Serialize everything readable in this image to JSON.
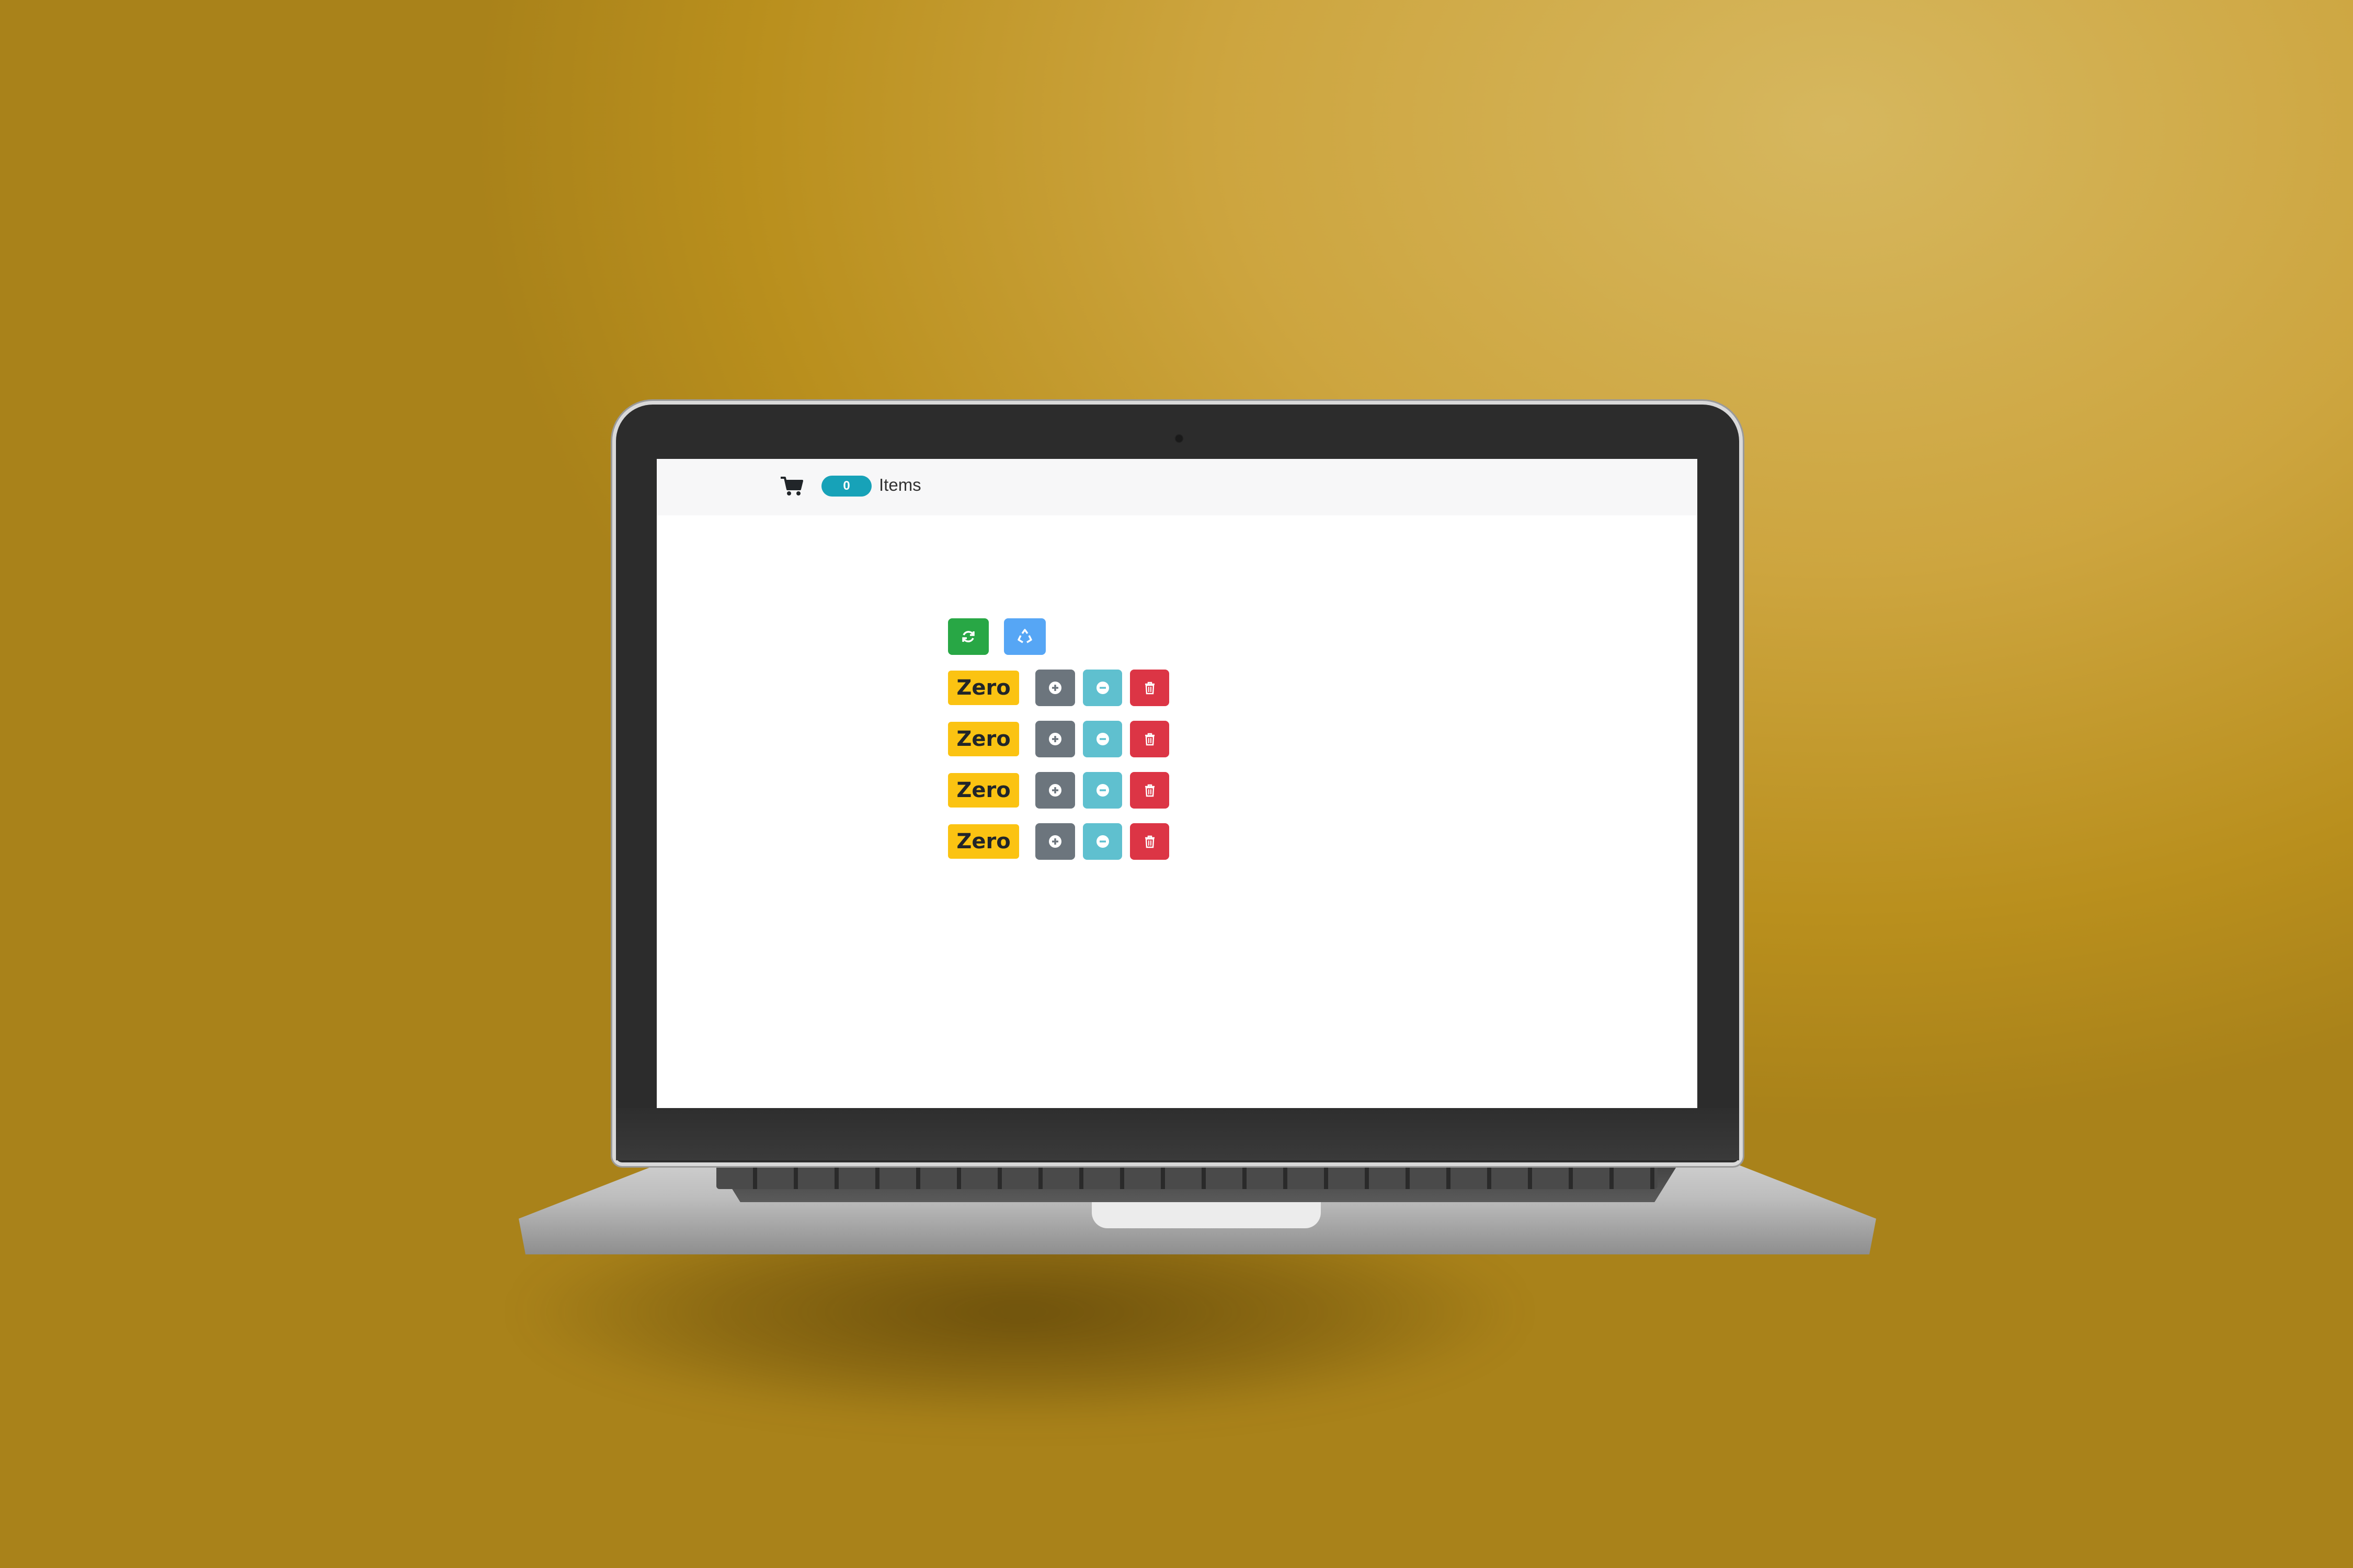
{
  "navbar": {
    "cart_icon": "cart-icon",
    "cart_count": "0",
    "items_label": "Items",
    "badge_color": "#17a2b8"
  },
  "toolbar": {
    "refresh_icon": "refresh-icon",
    "recycle_icon": "recycle-icon"
  },
  "counters": [
    {
      "label": "Zero",
      "increment_icon": "plus-circle-icon",
      "decrement_icon": "minus-circle-icon",
      "delete_icon": "trash-icon"
    },
    {
      "label": "Zero",
      "increment_icon": "plus-circle-icon",
      "decrement_icon": "minus-circle-icon",
      "delete_icon": "trash-icon"
    },
    {
      "label": "Zero",
      "increment_icon": "plus-circle-icon",
      "decrement_icon": "minus-circle-icon",
      "delete_icon": "trash-icon"
    },
    {
      "label": "Zero",
      "increment_icon": "plus-circle-icon",
      "decrement_icon": "minus-circle-icon",
      "delete_icon": "trash-icon"
    }
  ],
  "colors": {
    "background": "#c9a23c",
    "zero_badge": "#fbc312",
    "refresh_button": "#28a745",
    "recycle_button": "#56a6f5",
    "increment_button": "#6c757d",
    "decrement_button": "#5fc0cf",
    "delete_button": "#dc3545"
  }
}
